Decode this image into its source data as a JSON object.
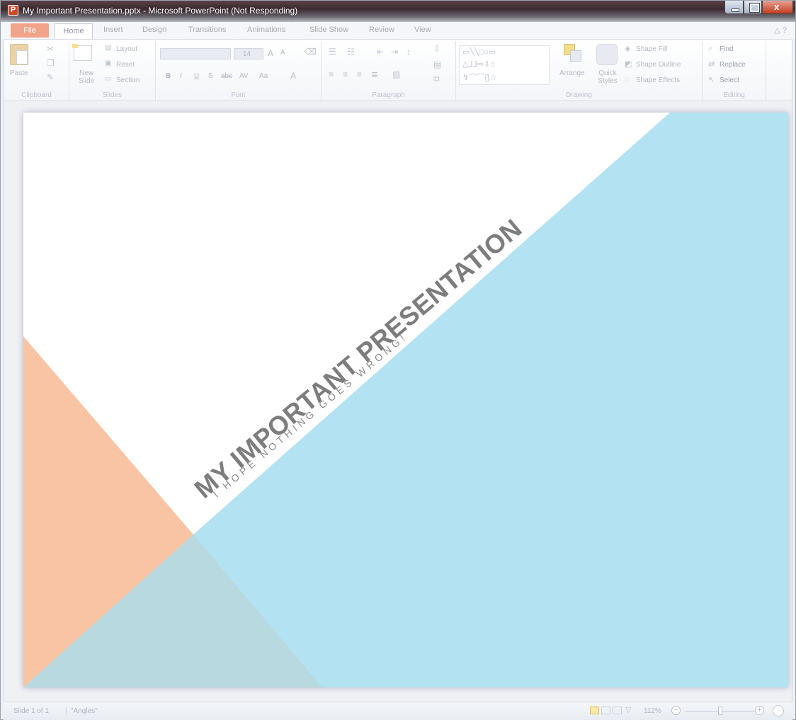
{
  "window": {
    "title": "My Important Presentation.pptx - Microsoft PowerPoint (Not Responding)",
    "app_icon_letter": "P",
    "close_glyph": "x"
  },
  "ribbon_tabs": {
    "file": "File",
    "home": "Home",
    "insert": "Insert",
    "design": "Design",
    "transitions": "Transitions",
    "animations": "Animations",
    "slide_show": "Slide Show",
    "review": "Review",
    "view": "View",
    "help_glyphs": "△ ?"
  },
  "clipboard": {
    "paste": "Paste",
    "label": "Clipboard"
  },
  "slides_group": {
    "new_slide": "New Slide",
    "layout": "Layout",
    "reset": "Reset",
    "section": "Section",
    "label": "Slides"
  },
  "font_group": {
    "size": "14",
    "bold": "B",
    "italic": "I",
    "underline": "U",
    "strike": "S",
    "abc": "abc",
    "spacing": "AV",
    "case": "Aa",
    "grow": "A",
    "shrink": "A",
    "color": "A",
    "label": "Font"
  },
  "paragraph_group": {
    "label": "Paragraph"
  },
  "drawing_group": {
    "arrange": "Arrange",
    "quick_styles": "Quick Styles",
    "shape_fill": "Shape Fill",
    "shape_outline": "Shape Outline",
    "shape_effects": "Shape Effects",
    "label": "Drawing"
  },
  "editing_group": {
    "find": "Find",
    "replace": "Replace",
    "select": "Select",
    "label": "Editing"
  },
  "slide": {
    "title": "MY IMPORTANT PRESENTATION",
    "subtitle": "I HOPE NOTHING GOES WRONG!",
    "colors": {
      "blue": "#b3e2f2",
      "peach": "#f9c4a4",
      "overlap": "#b9d9e1",
      "title_text": "#7d7d7d"
    }
  },
  "statusbar": {
    "slide_position": "Slide 1 of 1",
    "theme": "\"Angles\"",
    "zoom": "112%",
    "zoom_out": "−",
    "zoom_in": "+"
  }
}
